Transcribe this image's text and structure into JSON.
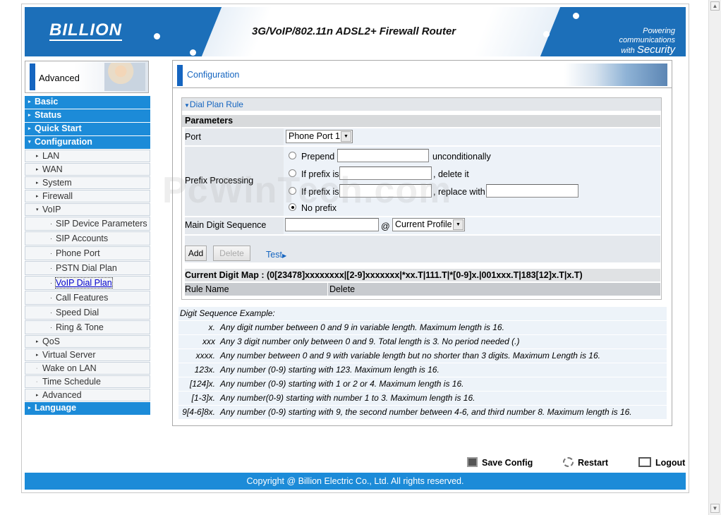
{
  "header": {
    "logo": "BILLION",
    "title": "3G/VoIP/802.11n ADSL2+ Firewall Router",
    "powering": "Powering communications",
    "with": "with",
    "security": "Security"
  },
  "advanced_label": "Advanced",
  "nav": [
    {
      "label": "Basic",
      "level": "top",
      "arrow": "▸"
    },
    {
      "label": "Status",
      "level": "top",
      "arrow": "▸"
    },
    {
      "label": "Quick Start",
      "level": "top",
      "arrow": "▸"
    },
    {
      "label": "Configuration",
      "level": "top",
      "arrow": "▾"
    },
    {
      "label": "LAN",
      "level": "sub",
      "arrow": "▸"
    },
    {
      "label": "WAN",
      "level": "sub",
      "arrow": "▸"
    },
    {
      "label": "System",
      "level": "sub",
      "arrow": "▸"
    },
    {
      "label": "Firewall",
      "level": "sub",
      "arrow": "▸"
    },
    {
      "label": "VoIP",
      "level": "sub",
      "arrow": "▾"
    },
    {
      "label": "SIP Device Parameters",
      "level": "sub2",
      "arrow": "·"
    },
    {
      "label": "SIP Accounts",
      "level": "sub2",
      "arrow": "·"
    },
    {
      "label": "Phone Port",
      "level": "sub2",
      "arrow": "·"
    },
    {
      "label": "PSTN Dial Plan",
      "level": "sub2",
      "arrow": "·"
    },
    {
      "label": "VoIP Dial Plan",
      "level": "sub2",
      "arrow": "·",
      "current": true
    },
    {
      "label": "Call Features",
      "level": "sub2",
      "arrow": "·"
    },
    {
      "label": "Speed Dial",
      "level": "sub2",
      "arrow": "·"
    },
    {
      "label": "Ring & Tone",
      "level": "sub2",
      "arrow": "·"
    },
    {
      "label": "QoS",
      "level": "sub",
      "arrow": "▸"
    },
    {
      "label": "Virtual Server",
      "level": "sub",
      "arrow": "▸"
    },
    {
      "label": "Wake on LAN",
      "level": "sub",
      "arrow": "·"
    },
    {
      "label": "Time Schedule",
      "level": "sub",
      "arrow": "·"
    },
    {
      "label": "Advanced",
      "level": "sub",
      "arrow": "▸"
    },
    {
      "label": "Language",
      "level": "top",
      "arrow": "▸"
    }
  ],
  "page_title": "Configuration",
  "dial_plan": {
    "section_title": "Dial Plan Rule",
    "parameters_label": "Parameters",
    "port_label": "Port",
    "port_value": "Phone Port 1",
    "prefix_label": "Prefix Processing",
    "prepend": "Prepend",
    "unconditionally": "unconditionally",
    "if_prefix_is": "If prefix is",
    "delete_it": ", delete it",
    "replace_with": ", replace with",
    "no_prefix": "No prefix",
    "selected_option": "No prefix",
    "main_digit_label": "Main Digit Sequence",
    "at": "@",
    "profile_value": "Current Profile",
    "add": "Add",
    "delete": "Delete",
    "test": "Test",
    "current_map": "Current Digit Map : (0[23478]xxxxxxxx|[2-9]xxxxxxx|*xx.T|111.T|*[0-9]x.|001xxx.T|183[12]x.T|x.T)",
    "col_rule": "Rule Name",
    "col_delete": "Delete"
  },
  "examples": {
    "title": "Digit Sequence Example:",
    "rows": [
      {
        "k": "x.",
        "v": "Any digit number between 0 and 9 in variable length. Maximum length is 16."
      },
      {
        "k": "xxx",
        "v": "Any 3 digit number only between 0 and 9. Total length is 3. No period needed (.)"
      },
      {
        "k": "xxxx.",
        "v": "Any number between 0 and 9 with variable length but no shorter than 3 digits. Maximum Length is 16."
      },
      {
        "k": "123x.",
        "v": "Any number (0-9) starting with 123. Maximum length is 16."
      },
      {
        "k": "[124]x.",
        "v": "Any number (0-9) starting with 1 or 2 or 4. Maximum length is 16."
      },
      {
        "k": "[1-3]x.",
        "v": "Any number(0-9) starting with number 1 to 3. Maximum length is 16."
      },
      {
        "k": "9[4-6]8x.",
        "v": "Any number (0-9) starting with 9, the second number between 4-6, and third number 8. Maximum length is 16."
      }
    ]
  },
  "actions": {
    "save": "Save Config",
    "restart": "Restart",
    "logout": "Logout"
  },
  "footer": "Copyright @ Billion Electric Co., Ltd. All rights reserved.",
  "watermark": "PcWinTech.com"
}
